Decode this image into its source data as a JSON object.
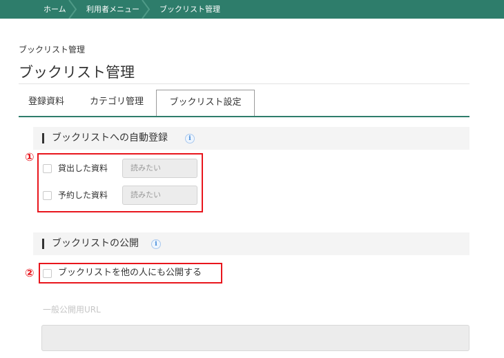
{
  "breadcrumb": {
    "items": [
      "ホーム",
      "利用者メニュー",
      "ブックリスト管理"
    ]
  },
  "header": {
    "subtitle": "ブックリスト管理",
    "title": "ブックリスト管理"
  },
  "tabs": [
    {
      "label": "登録資料",
      "active": false
    },
    {
      "label": "カテゴリ管理",
      "active": false
    },
    {
      "label": "ブックリスト設定",
      "active": true
    }
  ],
  "auto_register": {
    "heading": "ブックリストへの自動登録",
    "info_icon": "info-icon",
    "marker": "①",
    "rows": [
      {
        "label": "貸出した資料",
        "value": "読みたい"
      },
      {
        "label": "予約した資料",
        "value": "読みたい"
      }
    ]
  },
  "publish": {
    "heading": "ブックリストの公開",
    "info_icon": "info-icon",
    "marker": "②",
    "checkbox_label": "ブックリストを他の人にも公開する",
    "url_label": "一般公開用URL",
    "url_value": ""
  },
  "colors": {
    "accent": "#2e7d6b",
    "annotation_red": "#e8151c",
    "info_blue": "#3d86d8"
  }
}
